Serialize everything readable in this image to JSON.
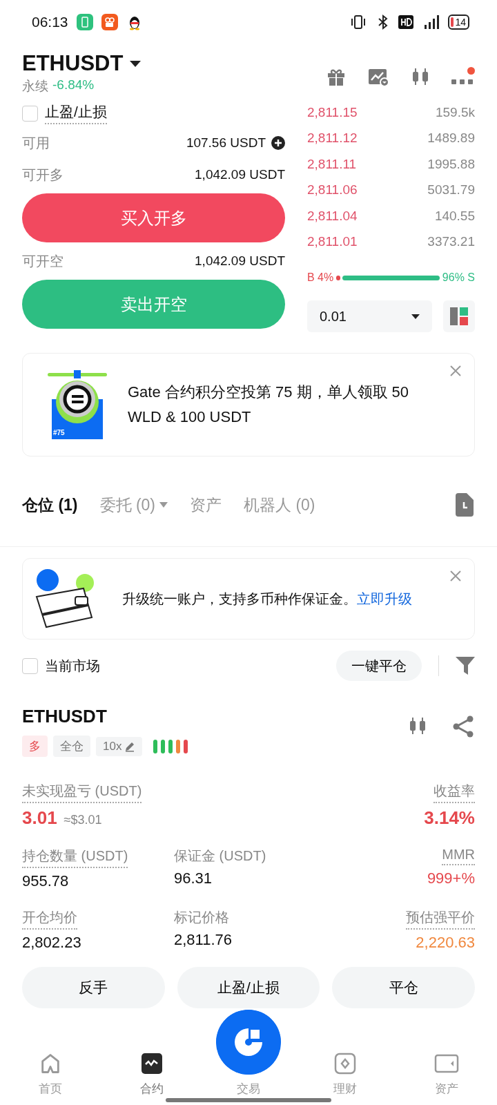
{
  "status_bar": {
    "time": "06:13",
    "battery": "14"
  },
  "header": {
    "symbol": "ETHUSDT",
    "type": "永续",
    "change": "-6.84%",
    "has_notification": true
  },
  "order_form": {
    "tpsl": {
      "label": "止盈/止损",
      "checked": false
    },
    "available": {
      "label": "可用",
      "value": "107.56 USDT"
    },
    "max_long": {
      "label": "可开多",
      "value": "1,042.09 USDT"
    },
    "buy_button": "买入开多",
    "max_short": {
      "label": "可开空",
      "value": "1,042.09 USDT"
    },
    "sell_button": "卖出开空"
  },
  "order_book": {
    "asks": [
      {
        "price": "2,811.15",
        "amount": "159.5k"
      },
      {
        "price": "2,811.12",
        "amount": "1489.89"
      },
      {
        "price": "2,811.11",
        "amount": "1995.88"
      },
      {
        "price": "2,811.06",
        "amount": "5031.79"
      },
      {
        "price": "2,811.04",
        "amount": "140.55"
      },
      {
        "price": "2,811.01",
        "amount": "3373.21"
      }
    ],
    "ratio": {
      "buy_label": "B 4%",
      "sell_label": "96% S"
    },
    "precision": "0.01"
  },
  "promo": {
    "badge": "#75",
    "text": "Gate 合约积分空投第 75 期，单人领取 50 WLD & 100 USDT"
  },
  "tabs": [
    {
      "label": "仓位 (1)",
      "selected": true,
      "dropdown": false
    },
    {
      "label": "委托 (0)",
      "selected": false,
      "dropdown": true
    },
    {
      "label": "资产",
      "selected": false,
      "dropdown": false
    },
    {
      "label": "机器人 (0)",
      "selected": false,
      "dropdown": false
    }
  ],
  "upgrade": {
    "text": "升级统一账户，支持多币种作保证金。",
    "link": "立即升级"
  },
  "filter_row": {
    "current_market": {
      "label": "当前市场",
      "checked": false
    },
    "close_all": "一键平仓"
  },
  "position": {
    "symbol": "ETHUSDT",
    "side": "多",
    "margin_mode": "全仓",
    "leverage": "10x",
    "risk_bars": [
      {
        "color": "#2ebd5a"
      },
      {
        "color": "#2ebd5a"
      },
      {
        "color": "#2ebd5a"
      },
      {
        "color": "#f0883e"
      },
      {
        "color": "#e5484d"
      }
    ],
    "fields": [
      {
        "label": "未实现盈亏 (USDT)",
        "value": "3.01",
        "approx": "≈$3.01",
        "color": "#e5484d",
        "dotted": true,
        "large": true
      },
      {
        "label": "收益率",
        "value": "3.14%",
        "color": "#e5484d",
        "dotted": true,
        "large": true
      },
      {
        "label": "持仓数量 (USDT)",
        "value": "955.78",
        "color": "#111111",
        "dotted": true,
        "large": false
      },
      {
        "label": "保证金 (USDT)",
        "value": "96.31",
        "color": "#111111",
        "dotted": false,
        "large": false
      },
      {
        "label": "MMR",
        "value": "999+%",
        "color": "#e5484d",
        "dotted": true,
        "large": false
      },
      {
        "label": "开仓均价",
        "value": "2,802.23",
        "color": "#111111",
        "dotted": true,
        "large": false
      },
      {
        "label": "标记价格",
        "value": "2,811.76",
        "color": "#111111",
        "dotted": false,
        "large": false
      },
      {
        "label": "预估强平价",
        "value": "2,220.63",
        "color": "#f0883e",
        "dotted": true,
        "large": false
      }
    ],
    "actions": [
      "反手",
      "止盈/止损",
      "平仓"
    ]
  },
  "bottom_nav": [
    {
      "label": "首页",
      "kind": "home",
      "selected": false
    },
    {
      "label": "合约",
      "kind": "futures",
      "selected": true
    },
    {
      "label": "交易",
      "kind": "fab",
      "selected": false
    },
    {
      "label": "理财",
      "kind": "finance",
      "selected": false
    },
    {
      "label": "资产",
      "kind": "assets",
      "selected": false
    }
  ]
}
